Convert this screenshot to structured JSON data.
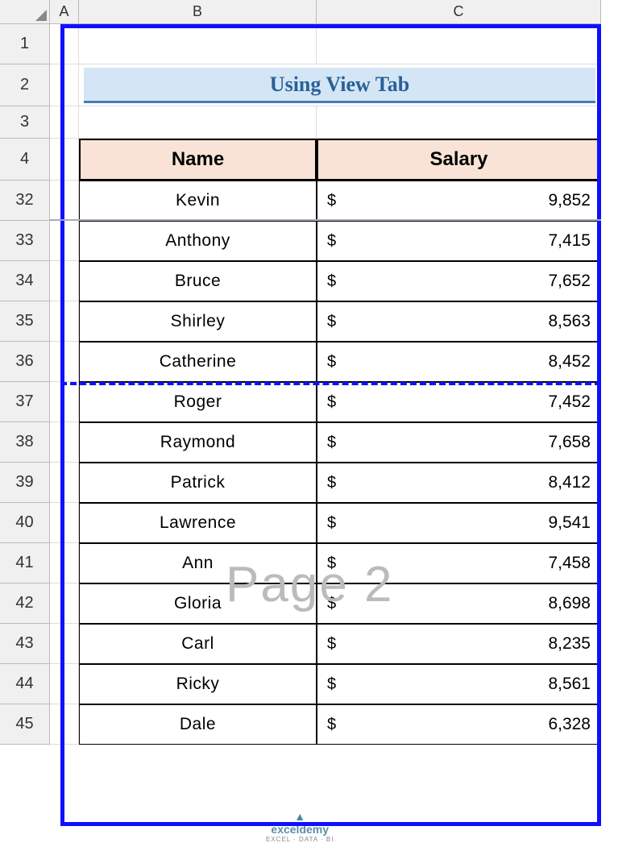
{
  "columns": [
    "A",
    "B",
    "C"
  ],
  "row_numbers": [
    "1",
    "2",
    "3",
    "4",
    "32",
    "33",
    "34",
    "35",
    "36",
    "37",
    "38",
    "39",
    "40",
    "41",
    "42",
    "43",
    "44",
    "45"
  ],
  "title": "Using View Tab",
  "headers": {
    "name": "Name",
    "salary": "Salary"
  },
  "rows": [
    {
      "name": "Kevin",
      "currency": "$",
      "salary": "9,852"
    },
    {
      "name": "Anthony",
      "currency": "$",
      "salary": "7,415"
    },
    {
      "name": "Bruce",
      "currency": "$",
      "salary": "7,652"
    },
    {
      "name": "Shirley",
      "currency": "$",
      "salary": "8,563"
    },
    {
      "name": "Catherine",
      "currency": "$",
      "salary": "8,452"
    },
    {
      "name": "Roger",
      "currency": "$",
      "salary": "7,452"
    },
    {
      "name": "Raymond",
      "currency": "$",
      "salary": "7,658"
    },
    {
      "name": "Patrick",
      "currency": "$",
      "salary": "8,412"
    },
    {
      "name": "Lawrence",
      "currency": "$",
      "salary": "9,541"
    },
    {
      "name": "Ann",
      "currency": "$",
      "salary": "7,458"
    },
    {
      "name": "Gloria",
      "currency": "$",
      "salary": "8,698"
    },
    {
      "name": "Carl",
      "currency": "$",
      "salary": "8,235"
    },
    {
      "name": "Ricky",
      "currency": "$",
      "salary": "8,561"
    },
    {
      "name": "Dale",
      "currency": "$",
      "salary": "6,328"
    }
  ],
  "watermark": {
    "page": "Page 2",
    "brand": "exceldemy",
    "tagline": "EXCEL · DATA · BI"
  }
}
